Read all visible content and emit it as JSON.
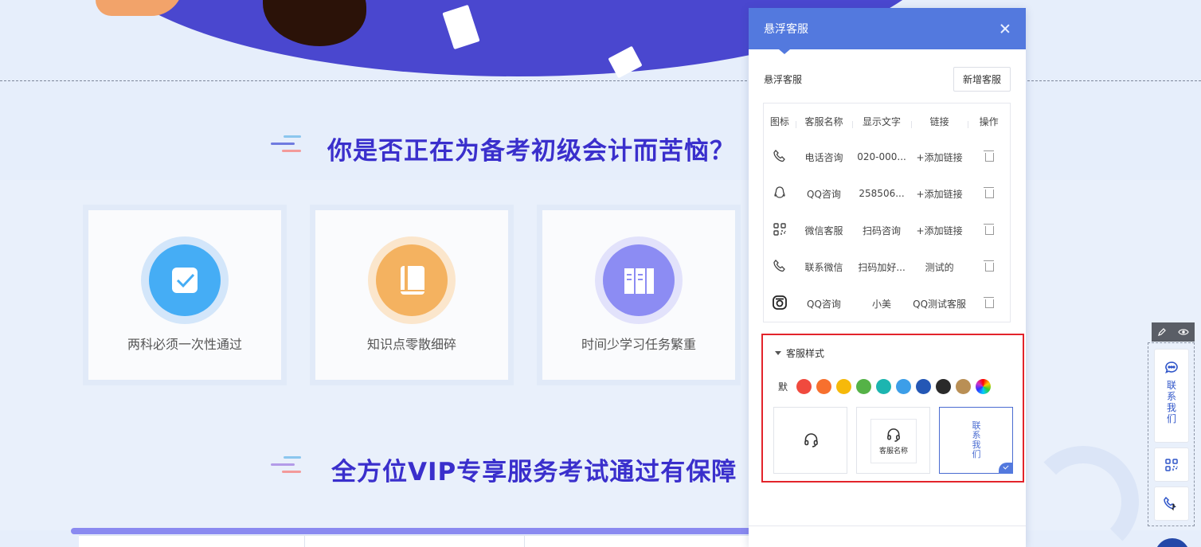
{
  "page": {
    "section1_title": "你是否正在为备考初级会计而苦恼？",
    "section2_title": "全方位VIP专享服务考试通过有保障",
    "cards": [
      {
        "caption": "两科必须一次性通过",
        "icon": "checkbox-icon",
        "color": "#45adf5"
      },
      {
        "caption": "知识点零散细碎",
        "icon": "book-icon",
        "color": "#f4b260"
      },
      {
        "caption": "时间少学习任务繁重",
        "icon": "books-icon",
        "color": "#8c8cf3"
      }
    ]
  },
  "panel": {
    "title": "悬浮客服",
    "label": "悬浮客服",
    "add_button": "新增客服",
    "columns": [
      "图标",
      "客服名称",
      "显示文字",
      "链接",
      "操作"
    ],
    "rows": [
      {
        "icon": "phone-icon",
        "name": "电话咨询",
        "text": "020-000...",
        "link": "+添加链接"
      },
      {
        "icon": "qq-icon",
        "name": "QQ咨询",
        "text": "258506...",
        "link": "+添加链接"
      },
      {
        "icon": "qrcode-icon",
        "name": "微信客服",
        "text": "扫码咨询",
        "link": "+添加链接"
      },
      {
        "icon": "phone-icon",
        "name": "联系微信",
        "text": "扫码加好...",
        "link": "测试的"
      },
      {
        "icon": "instagram-icon",
        "name": "QQ咨询",
        "text": "小美",
        "link": "QQ测试客服"
      }
    ],
    "style_section": {
      "title": "客服样式",
      "default_label": "默",
      "colors": [
        "#f04a3e",
        "#f7702e",
        "#f6b90a",
        "#55b247",
        "#1cb5b0",
        "#3c9ee8",
        "#2457b5",
        "#2a2a2a",
        "#b98f55",
        "rainbow"
      ],
      "options": [
        {
          "type": "icon-only"
        },
        {
          "type": "icon-with-name",
          "name": "客服名称"
        },
        {
          "type": "vertical-text",
          "text": "联系我们",
          "selected": true
        }
      ]
    }
  },
  "widget": {
    "contact_text": "联系我们",
    "buttons": [
      "chat-icon",
      "qrcode-icon",
      "phone-icon"
    ]
  }
}
